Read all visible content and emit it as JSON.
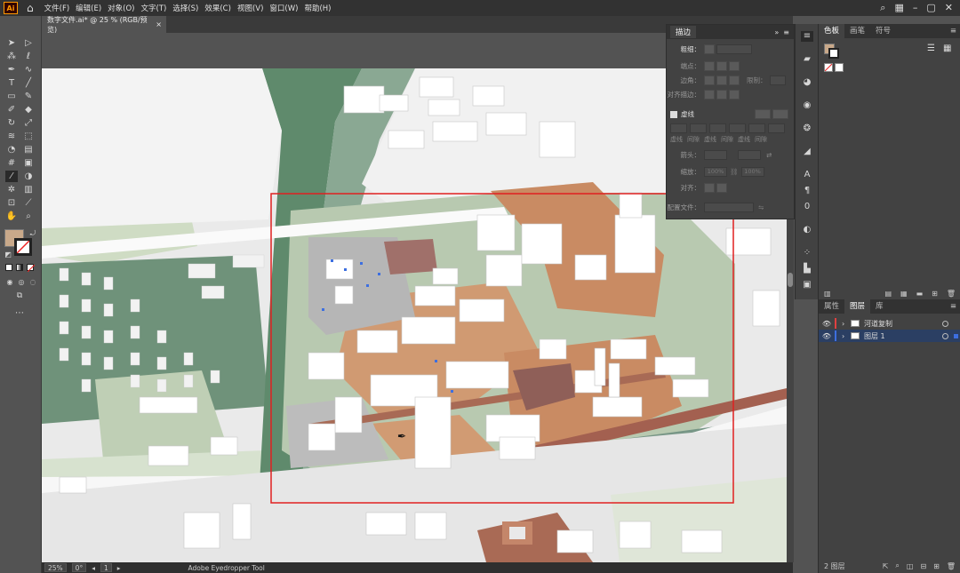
{
  "menubar": {
    "logo": "Ai",
    "items": [
      "文件(F)",
      "编辑(E)",
      "对象(O)",
      "文字(T)",
      "选择(S)",
      "效果(C)",
      "视图(V)",
      "窗口(W)",
      "帮助(H)"
    ]
  },
  "document": {
    "tab_title": "数字文件.ai* @ 25 % (RGB/预览)",
    "tab_close": "×"
  },
  "stroke_panel": {
    "title": "描边",
    "collapse": "»",
    "menu": "≡",
    "weight_label": "粗细：",
    "cap_label": "端点：",
    "corner_label": "边角：",
    "limit_label": "限制：",
    "align_label": "对齐描边：",
    "dashed_label": "虚线",
    "dash_labels": [
      "虚线",
      "间隙",
      "虚线",
      "间隙",
      "虚线",
      "间隙"
    ],
    "arrow_label": "箭头：",
    "scale_label": "缩放：",
    "scale_values": [
      "100%",
      "100%"
    ],
    "align_arrow_label": "对齐：",
    "profile_label": "配置文件："
  },
  "right_panel": {
    "top_tabs": [
      "色板",
      "画笔",
      "符号"
    ],
    "layers_tabs": [
      "属性",
      "图层",
      "库"
    ],
    "layers": [
      {
        "name": "河道复制",
        "color": "#e04040"
      },
      {
        "name": "图层 1",
        "color": "#3d6fe0"
      }
    ],
    "layers_count": "2 图层"
  },
  "status": {
    "zoom": "25%",
    "rotation": "0°",
    "artboard": "1",
    "tool_name": "Adobe Eyedropper Tool"
  }
}
